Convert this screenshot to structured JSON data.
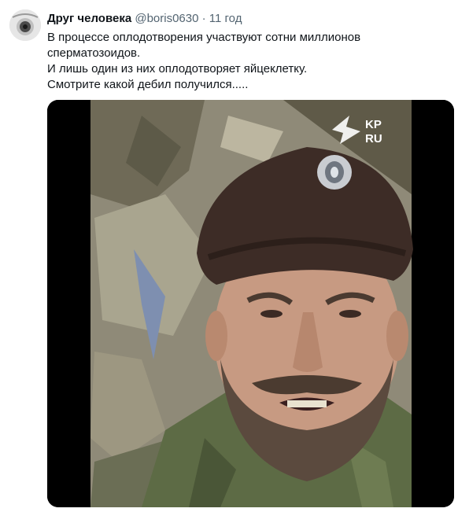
{
  "tweet": {
    "author_name": "Друг человека",
    "author_handle": "@boris0630",
    "separator": "·",
    "timestamp": "11 год",
    "text_lines": [
      "В процессе оплодотворения участвуют сотни миллионов",
      "сперматозоидов.",
      "И лишь один из них оплодотворяет яйцеклетку.",
      "Смотрите какой дебил получился....."
    ],
    "media_watermark": "KP RU"
  },
  "colors": {
    "text": "#0f1419",
    "secondary": "#536471",
    "media_bg": "#000000"
  }
}
